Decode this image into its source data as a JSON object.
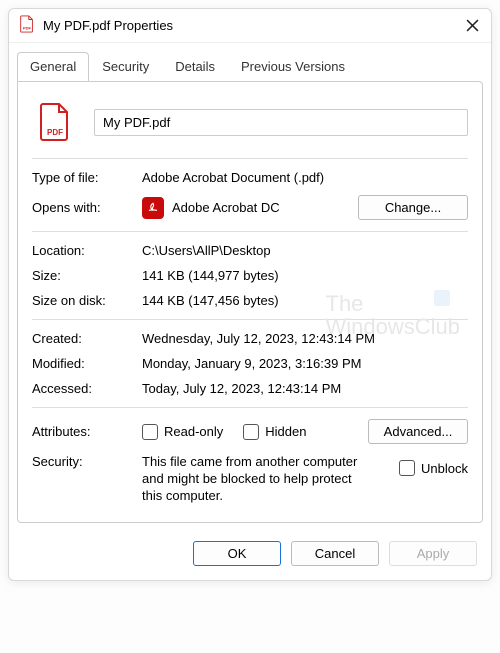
{
  "titlebar": {
    "icon": "pdf-file-icon",
    "title": "My PDF.pdf Properties"
  },
  "tabs": [
    "General",
    "Security",
    "Details",
    "Previous Versions"
  ],
  "active_tab": 0,
  "filename": "My PDF.pdf",
  "type_of_file": {
    "label": "Type of file:",
    "value": "Adobe Acrobat Document (.pdf)"
  },
  "opens_with": {
    "label": "Opens with:",
    "value": "Adobe Acrobat DC",
    "button": "Change..."
  },
  "location": {
    "label": "Location:",
    "value": "C:\\Users\\AllP\\Desktop"
  },
  "size": {
    "label": "Size:",
    "value": "141 KB (144,977 bytes)"
  },
  "size_on_disk": {
    "label": "Size on disk:",
    "value": "144 KB (147,456 bytes)"
  },
  "created": {
    "label": "Created:",
    "value": "Wednesday, July 12, 2023, 12:43:14 PM"
  },
  "modified": {
    "label": "Modified:",
    "value": "Monday, January 9, 2023, 3:16:39 PM"
  },
  "accessed": {
    "label": "Accessed:",
    "value": "Today, July 12, 2023, 12:43:14 PM"
  },
  "attributes": {
    "label": "Attributes:",
    "readonly": "Read-only",
    "hidden": "Hidden",
    "advanced": "Advanced..."
  },
  "security": {
    "label": "Security:",
    "text": "This file came from another computer and might be blocked to help protect this computer.",
    "unblock": "Unblock"
  },
  "footer": {
    "ok": "OK",
    "cancel": "Cancel",
    "apply": "Apply"
  },
  "watermark": {
    "line1": "The",
    "line2": "WindowsClub"
  }
}
